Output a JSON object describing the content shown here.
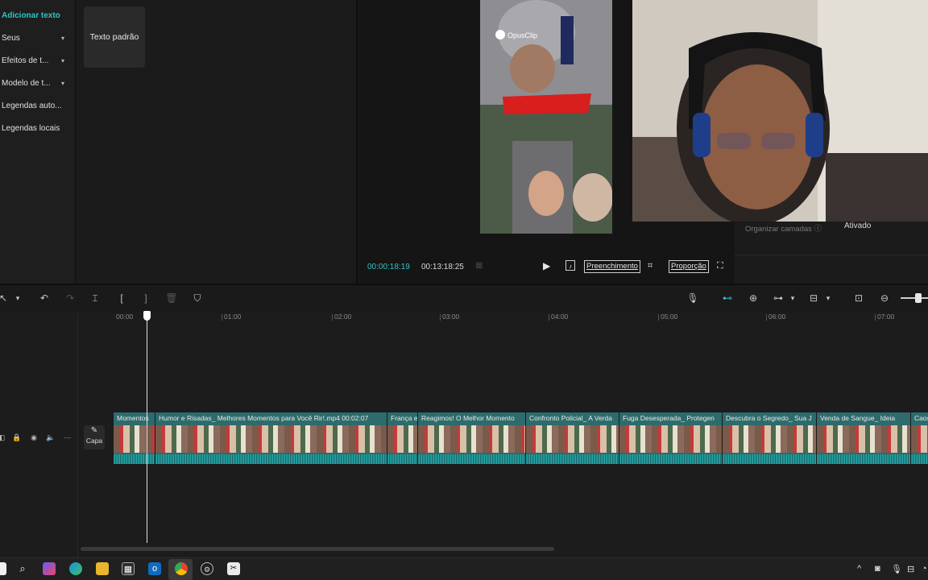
{
  "sidebar": {
    "items": [
      {
        "label": "Adicionar texto",
        "active": true,
        "has_dropdown": false
      },
      {
        "label": "Seus",
        "active": false,
        "has_dropdown": true
      },
      {
        "label": "Efeitos de t...",
        "active": false,
        "has_dropdown": true
      },
      {
        "label": "Modelo de t...",
        "active": false,
        "has_dropdown": true
      },
      {
        "label": "Legendas auto...",
        "active": false,
        "has_dropdown": false
      },
      {
        "label": "Legendas locais",
        "active": false,
        "has_dropdown": false
      }
    ]
  },
  "text_panel": {
    "card_label": "Texto padrão"
  },
  "player": {
    "current_time": "00:00:18:19",
    "total_time": "00:13:18:25",
    "fill_label": "Preenchimento",
    "ratio_label": "Proporção",
    "watermark": "OpusClip"
  },
  "properties": {
    "layers_label": "Organizar camadas ⓘ",
    "layers_value": "Ativado"
  },
  "ruler": {
    "labels": [
      "00:00",
      "01:00",
      "02:00",
      "03:00",
      "04:00",
      "05:00",
      "06:00",
      "07:00"
    ]
  },
  "track": {
    "cover_label": "Capa",
    "clips": [
      {
        "title": "Momentos"
      },
      {
        "title": "Humor e Risadas_ Melhores Momentos para Você Rir!.mp4  00:02:07"
      },
      {
        "title": "França e"
      },
      {
        "title": "Reagimos! O Melhor Momento"
      },
      {
        "title": "Confronto Policial_ A Verda"
      },
      {
        "title": "Fuga Desesperada_ Protegen"
      },
      {
        "title": "Descubra o Segredo_ Sua J"
      },
      {
        "title": "Venda de Sangue_ Ideia"
      },
      {
        "title": "Caos e"
      }
    ]
  },
  "colors": {
    "accent": "#2cc6c9",
    "clip": "#2d6b6c",
    "background": "#181818"
  }
}
